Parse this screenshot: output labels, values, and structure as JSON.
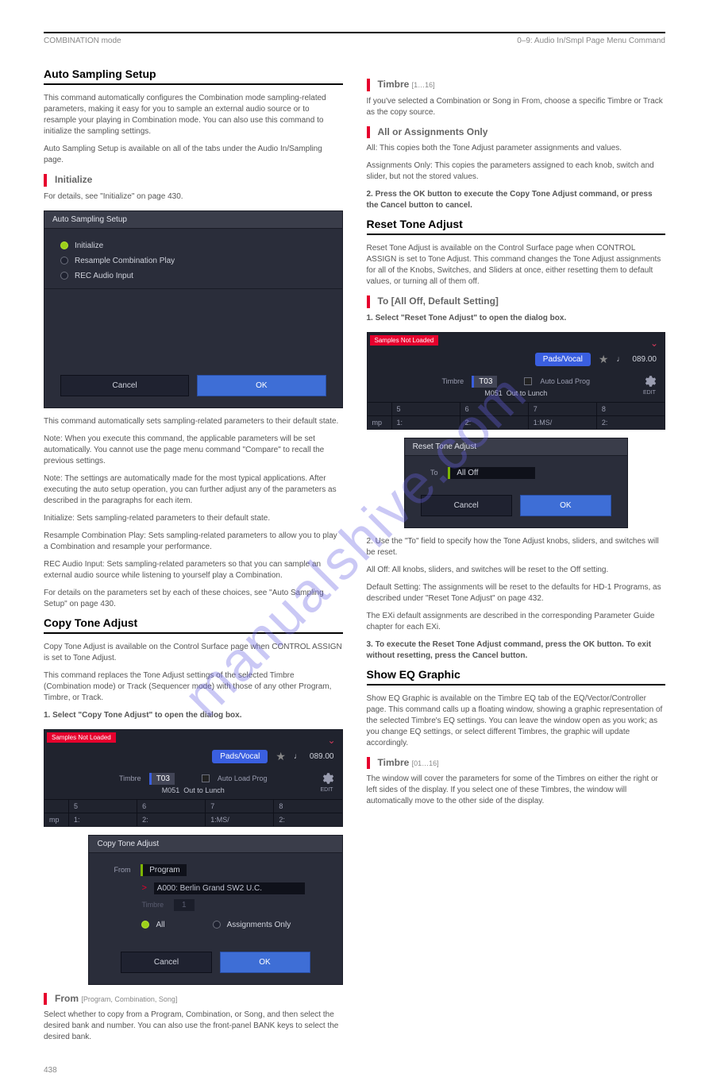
{
  "header": {
    "left": "COMBINATION mode",
    "right": "0–9: Audio In/Smpl Page Menu Command"
  },
  "common": {
    "cancel": "Cancel",
    "ok": "OK"
  },
  "watermark": "manualshive.com",
  "page_num": "438",
  "combibar": {
    "snl": "Samples Not Loaded",
    "category": "Pads/Vocal",
    "tempo": "089.00",
    "timbre_lbl": "Timbre",
    "timbre_val": "T03",
    "autoload": "Auto Load Prog",
    "edit": "EDIT",
    "prog": "M051",
    "progname": "Out to Lunch",
    "hdrs": [
      "5",
      "6",
      "7",
      "8"
    ],
    "row2": [
      "mp",
      "1:",
      "2:",
      "1:MS/",
      "2:"
    ]
  },
  "left": {
    "sec1": {
      "title": "Auto Sampling Setup",
      "p1": "This command automatically configures the Combination mode sampling-related parameters, making it easy for you to sample an external audio source or to resample your playing in Combination mode. You can also use this command to initialize the sampling settings.",
      "p2": "Auto Sampling Setup is available on all of the tabs under the Audio In/Sampling page.",
      "sub_initialize": "Initialize",
      "p3": "For details, see \"Initialize\" on page 430.",
      "p4": "This command automatically sets sampling-related parameters to their default state.",
      "p5": "Note: When you execute this command, the applicable parameters will be set automatically. You cannot use the page menu command \"Compare\" to recall the previous settings.",
      "p6": "Note: The settings are automatically made for the most typical applications. After executing the auto setup operation, you can further adjust any of the parameters as described in the paragraphs for each item.",
      "p7": "Initialize: Sets sampling-related parameters to their default state.",
      "p8": "Resample Combination Play: Sets sampling-related parameters to allow you to play a Combination and resample your performance.",
      "p9": "REC Audio Input: Sets sampling-related parameters so that you can sample an external audio source while listening to yourself play a Combination.",
      "p10": "For details on the parameters set by each of these choices, see \"Auto Sampling Setup\" on page 430."
    },
    "sec2": {
      "title": "Copy Tone Adjust",
      "p1": "Copy Tone Adjust is available on the Control Surface page when CONTROL ASSIGN is set to Tone Adjust.",
      "p2": "This command replaces the Tone Adjust settings of the selected Timbre (Combination mode) or Track (Sequencer mode) with those of any other Program, Timbre, or Track.",
      "p3": "1. Select \"Copy Tone Adjust\" to open the dialog box.",
      "sub_from": "From",
      "sub_from_range": "[Program, Combination, Song]",
      "p4": "Select whether to copy from a Program, Combination, or Song, and then select the desired bank and number. You can also use the front-panel BANK keys to select the desired bank."
    },
    "scrA": {
      "title": "Auto Sampling Setup",
      "opts": [
        "Initialize",
        "Resample Combination Play",
        "REC Audio Input"
      ]
    },
    "scrC": {
      "title": "Copy Tone Adjust",
      "from_lbl": "From",
      "from_val": "Program",
      "program": "A000: Berlin Grand SW2 U.C.",
      "timbre_lbl": "Timbre",
      "timbre_val": "1",
      "opt_all": "All",
      "opt_assign": "Assignments Only"
    }
  },
  "right": {
    "sec1": {
      "sub_timbre": "Timbre",
      "sub_timbre_range": "[1…16]",
      "p1": "If you've selected a Combination or Song in From, choose a specific Timbre or Track as the copy source.",
      "sub_all": "All or Assignments Only",
      "p2": "All: This copies both the Tone Adjust parameter assignments and values.",
      "p3": "Assignments Only: This copies the parameters assigned to each knob, switch and slider, but not the stored values.",
      "p4": "2. Press the OK button to execute the Copy Tone Adjust command, or press the Cancel button to cancel."
    },
    "sec2": {
      "title": "Reset Tone Adjust",
      "p1": "Reset Tone Adjust is available on the Control Surface page when CONTROL ASSIGN is set to Tone Adjust. This command changes the Tone Adjust assignments for all of the Knobs, Switches, and Sliders at once, either resetting them to default values, or turning all of them off.",
      "sub_to": "To  [All Off, Default Setting]",
      "p2": "1. Select \"Reset Tone Adjust\" to open the dialog box.",
      "p3": "2. Use the \"To\" field to specify how the Tone Adjust knobs, sliders, and switches will be reset.",
      "p4": "All Off: All knobs, sliders, and switches will be reset to the Off setting.",
      "p5": "Default Setting: The assignments will be reset to the defaults for HD-1 Programs, as described under \"Reset Tone Adjust\" on page 432.",
      "p6": "The EXi default assignments are described in the corresponding Parameter Guide chapter for each EXi.",
      "p7": "3. To execute the Reset Tone Adjust command, press the OK button. To exit without resetting, press the Cancel button."
    },
    "sec3": {
      "title": "Show EQ Graphic",
      "p1": "Show EQ Graphic is available on the Timbre EQ tab of the EQ/Vector/Controller page. This command calls up a floating window, showing a graphic representation of the selected Timbre's EQ settings. You can leave the window open as you work; as you change EQ settings, or select different Timbres, the graphic will update accordingly.",
      "sub_timbre": "Timbre",
      "sub_timbre_range": "[01…16]",
      "p2": "The window will cover the parameters for some of the Timbres on either the right or left sides of the display. If you select one of these Timbres, the window will automatically move to the other side of the display."
    },
    "scrD": {
      "title": "Reset Tone Adjust",
      "to_lbl": "To",
      "to_val": "All Off"
    }
  }
}
